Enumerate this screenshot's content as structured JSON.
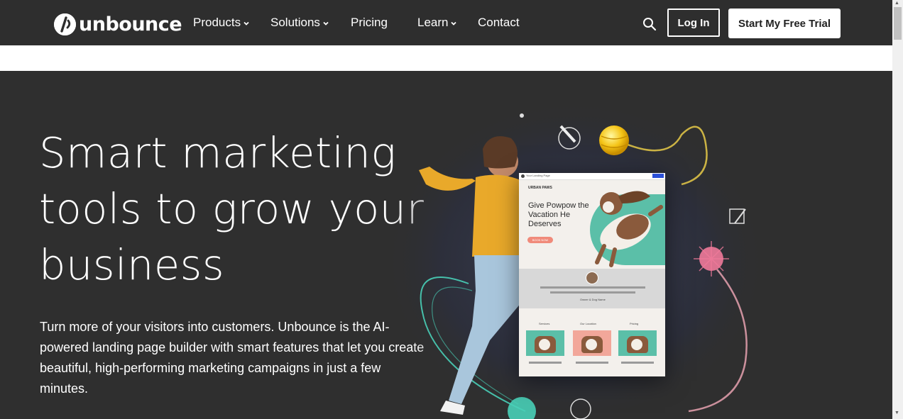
{
  "nav": {
    "logo_text": "unbounce",
    "items": [
      {
        "label": "Products",
        "has_dropdown": true
      },
      {
        "label": "Solutions",
        "has_dropdown": true
      },
      {
        "label": "Pricing",
        "has_dropdown": false
      },
      {
        "label": "Learn",
        "has_dropdown": true
      },
      {
        "label": "Contact",
        "has_dropdown": false
      }
    ],
    "login_label": "Log In",
    "trial_label": "Start My Free Trial",
    "search_icon": "search-icon"
  },
  "hero": {
    "headline": "Smart marketing tools to grow your business",
    "subtext": "Turn more of your visitors into customers. Unbounce is the AI-powered landing page builder with smart features that let you create beautiful, high-performing marketing campaigns in just a few minutes."
  },
  "mock_page": {
    "bar_title": "Your Landing Page",
    "brand": "URBAN PAWS",
    "headline": "Give Powpow the Vacation He Deserves",
    "button": "BOOK NOW",
    "caption": "Owner & Dog Name",
    "columns": [
      "Services",
      "Our Location",
      "Pricing"
    ]
  },
  "colors": {
    "nav_bg": "#2e2e2e",
    "hero_bg": "#2f2f2f",
    "teal": "#5bbfa8",
    "coral": "#f08a7a",
    "sweater": "#e9a92a"
  }
}
